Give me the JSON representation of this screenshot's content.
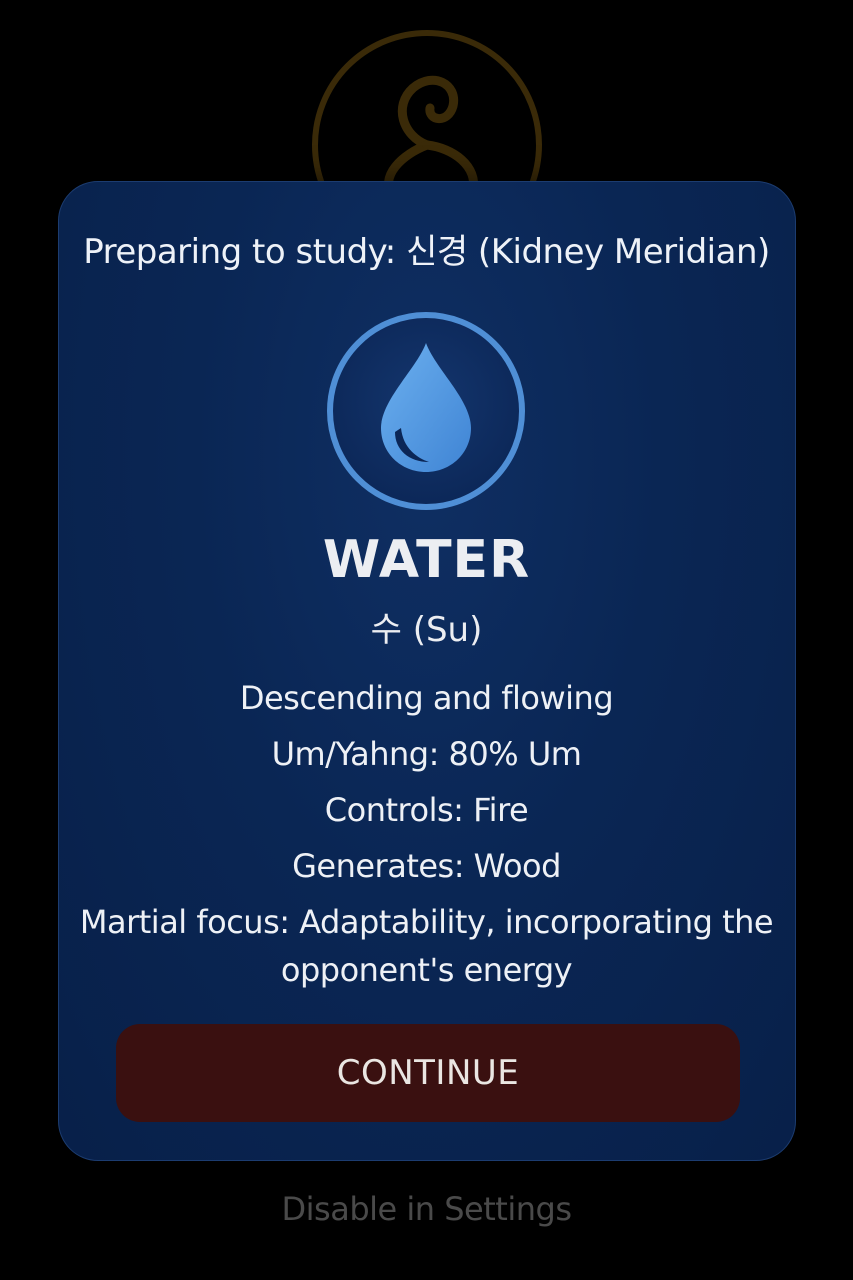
{
  "dialog": {
    "heading": "Preparing to study: 신경 (Kidney Meridian)",
    "element": {
      "icon": "water-drop-icon",
      "name": "WATER",
      "korean": "수 (Su)"
    },
    "details": [
      "Descending and flowing",
      "Um/Yahng: 80% Um",
      "Controls: Fire",
      "Generates: Wood",
      "Martial focus: Adaptability, incorporating the opponent's energy"
    ],
    "continue_label": "CONTINUE"
  },
  "footer": {
    "disable_label": "Disable in Settings"
  },
  "colors": {
    "background": "#000000",
    "card": "#0a2654",
    "accent_ring": "#4f8fd6",
    "drop": "#5a9de0",
    "button": "#3a1010",
    "emblem": "#3a2a08"
  }
}
